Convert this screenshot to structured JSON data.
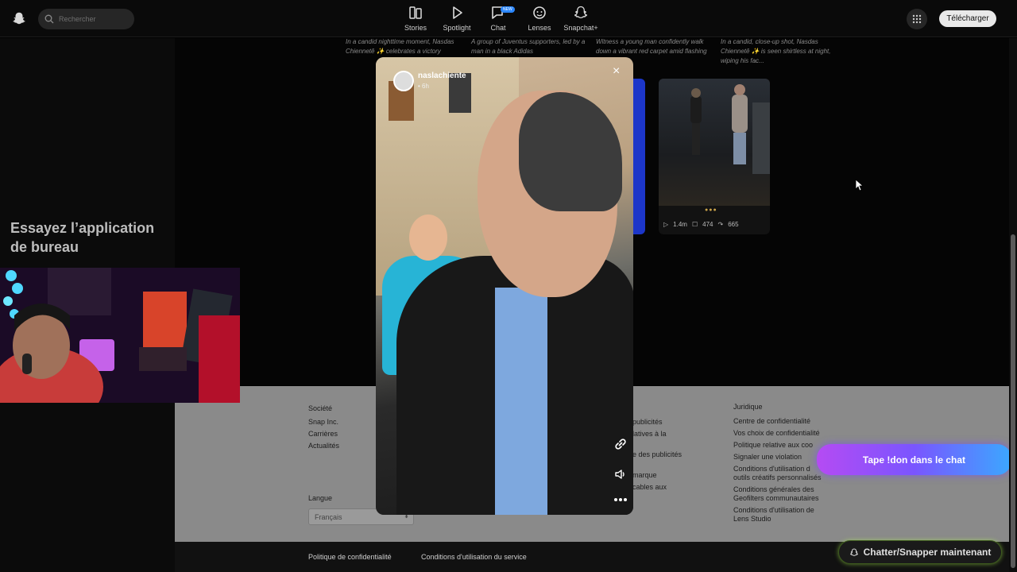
{
  "header": {
    "search_placeholder": "Rechercher",
    "nav": [
      {
        "label": "Stories",
        "icon": "stories-icon"
      },
      {
        "label": "Spotlight",
        "icon": "spotlight-icon"
      },
      {
        "label": "Chat",
        "icon": "chat-icon",
        "badge": "NEW"
      },
      {
        "label": "Lenses",
        "icon": "lenses-icon"
      },
      {
        "label": "Snapchat+",
        "icon": "snapchat-plus-icon"
      }
    ],
    "download_label": "Télécharger"
  },
  "sidebar": {
    "promo_title": "Essayez l’application de bureau"
  },
  "captions": [
    "In a candid nighttime moment, Nasdas Chiennetê ✨ celebrates a victory",
    "A group of Juventus supporters, led by a man in a black Adidas",
    "Witness a young man confidently walk down a vibrant red carpet amid flashing lights....",
    "In a candid, close-up shot, Nasdas Chiennetê ✨ is seen shirtless at night, wiping his fac..."
  ],
  "tile": {
    "views": "1.4m",
    "comments": "474",
    "shares": "665"
  },
  "story": {
    "username": "naslachiente",
    "time": "6h"
  },
  "footer": {
    "company": {
      "title": "Société",
      "links": [
        "Snap Inc.",
        "Carrières",
        "Actualités"
      ]
    },
    "ads_partial": [
      "publicités",
      "latives à la",
      "e des publicités",
      "marque",
      "cables aux"
    ],
    "legal": {
      "title": "Juridique",
      "links": [
        "Centre de confidentialité",
        "Vos choix de confidentialité",
        "Politique relative aux coo",
        "Signaler une violation",
        "Conditions d'utilisation d",
        "outils créatifs personnalisés",
        "Conditions générales des",
        "Geofilters communautaires",
        "Conditions d'utilisation de",
        "Lens Studio"
      ]
    },
    "language_label": "Langue",
    "language_value": "Français",
    "bottom_links": [
      "Politique de confidentialité",
      "Conditions d'utilisation du service"
    ]
  },
  "overlay": {
    "tape_label": "Tape !don dans le chat",
    "chat_label": "Chatter/Snapper maintenant"
  },
  "colors": {
    "accent_blue": "#2b87ff",
    "gradient_purple": "#b54bf3",
    "gradient_blue": "#3ba8ff"
  }
}
